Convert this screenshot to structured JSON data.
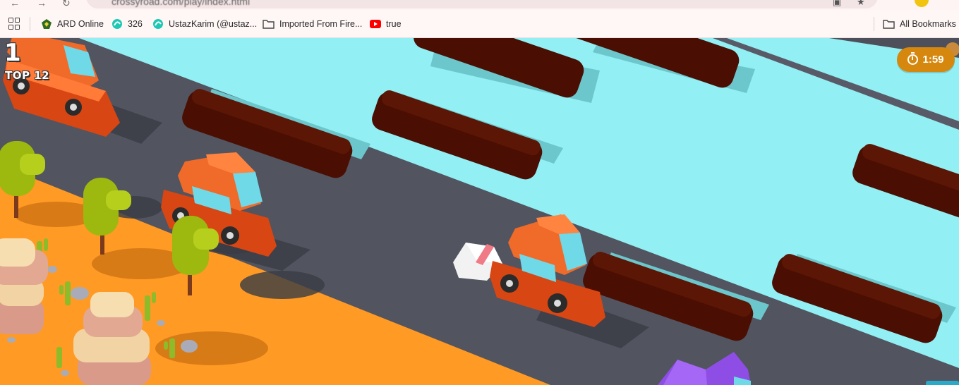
{
  "browser": {
    "address_text": "crossyroad.com/play/index.html",
    "bookmarks": [
      {
        "label": "ARD Online",
        "icon": "shield-favicon-icon"
      },
      {
        "label": "326",
        "icon": "teal-swirl-favicon-icon"
      },
      {
        "label": "UstazKarim (@ustaz...",
        "icon": "teal-swirl-favicon-icon"
      },
      {
        "label": "Imported From Fire...",
        "icon": "folder-icon"
      },
      {
        "label": "true",
        "icon": "youtube-favicon-icon"
      }
    ],
    "all_bookmarks_label": "All Bookmarks",
    "colors": {
      "toolbar_bg": "#fff6f6",
      "youtube_red": "#ff0000",
      "teal": "#1fc8b4"
    }
  },
  "game": {
    "score": "1",
    "top_label": "TOP 12",
    "timer": "1:59",
    "colors": {
      "road": "#52545f",
      "water": "#92eff4",
      "sand": "#ff9a24",
      "log": "#4a0e02",
      "car": "#ee5a1c",
      "car_window": "#6fd9e8",
      "tree": "#9db80f",
      "timer_bg": "#d5880d"
    },
    "icons": [
      "stopwatch-icon",
      "chicken-player",
      "car",
      "log",
      "tree",
      "cactus",
      "rock"
    ]
  }
}
